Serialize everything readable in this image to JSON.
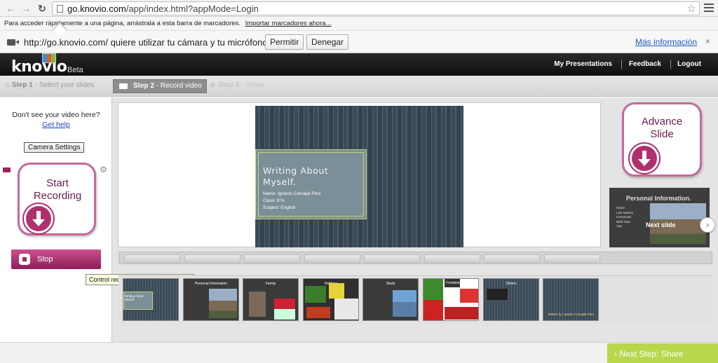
{
  "browser": {
    "url_domain": "go.knovio.com",
    "url_path": "/app/index.html?appMode=Login",
    "bookmarks_hint": "Para acceder rápidamente a una página, arrástrala a esta barra de marcadores.",
    "bookmarks_import": "Importar marcadores ahora..."
  },
  "infobar": {
    "message": "http://go.knovio.com/ quiere utilizar tu cámara y tu micrófono.",
    "allow_label": "Permitir",
    "deny_label": "Denegar",
    "more_info_label": "Más información",
    "close_glyph": "×"
  },
  "header": {
    "logo": "knovio",
    "beta": "Beta",
    "nav": [
      "My Presentations",
      "Feedback",
      "Logout"
    ]
  },
  "steps": [
    {
      "label": "Step 1",
      "text": " - Select your slides"
    },
    {
      "label": "Step 2",
      "text": " - Record video"
    },
    {
      "label": "Step 3",
      "text": " - Share"
    }
  ],
  "left": {
    "no_video": "Don't see your video here?",
    "get_help": "Get help",
    "camera_settings": "Camera Settings",
    "start_recording_line1": "Start",
    "start_recording_line2": "Recording",
    "stop_label": "Stop",
    "tooltip": "Control recording presentation video"
  },
  "slide": {
    "title_line1": "Writing About",
    "title_line2": "Myself.",
    "lines": [
      "Name: Ignacio Carvajal Pino",
      "Class: 8°A",
      "Subject: English"
    ]
  },
  "right": {
    "advance_line1": "Advance",
    "advance_line2": "Slide",
    "preview_title": "Personal Information.",
    "preview_list": [
      "Name",
      "Last Names",
      "Hometown",
      "Birth Date",
      "Age"
    ],
    "next_slide": "Next slide"
  },
  "thumbnails": [
    {
      "title": "Writing About Myself."
    },
    {
      "title": "Personal Information"
    },
    {
      "title": "Family"
    },
    {
      "title": "Hobbies"
    },
    {
      "title": "Study"
    },
    {
      "title": "Freetime"
    },
    {
      "title": "Others"
    },
    {
      "title": "Written by: Ignacio Carvajal Pino"
    }
  ],
  "footer": {
    "next_step": "Next Step: Share"
  }
}
